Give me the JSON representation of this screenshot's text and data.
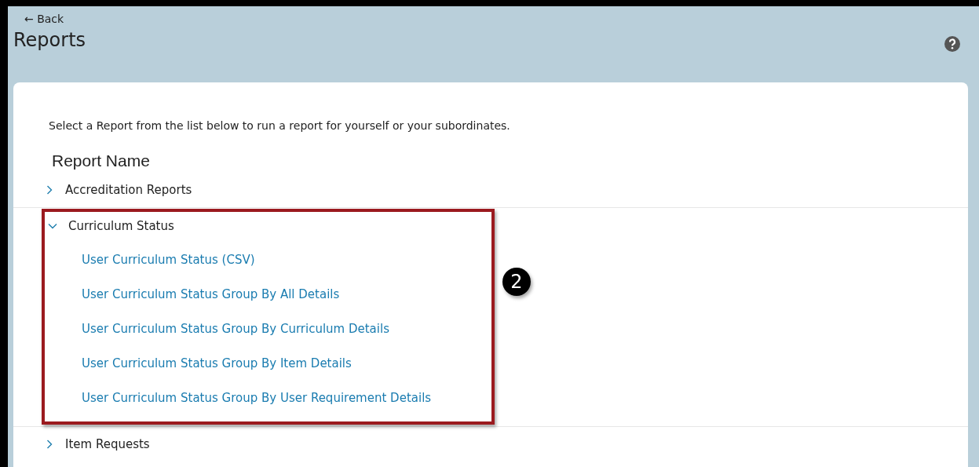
{
  "header": {
    "back": "← Back",
    "title": "Reports"
  },
  "intro": "Select a Report from the list below to run a report for yourself or your subordinates.",
  "list_heading": "Report Name",
  "groups": [
    {
      "label": "Accreditation Reports",
      "expanded": false,
      "highlighted": false
    },
    {
      "label": "Curriculum Status",
      "expanded": true,
      "highlighted": true,
      "callout": "2",
      "children": [
        "User Curriculum Status (CSV)",
        "User Curriculum Status Group By All Details",
        "User Curriculum Status Group By Curriculum Details",
        "User Curriculum Status Group By Item Details",
        "User Curriculum Status Group By User Requirement Details"
      ]
    },
    {
      "label": "Item Requests",
      "expanded": false,
      "highlighted": false
    }
  ]
}
